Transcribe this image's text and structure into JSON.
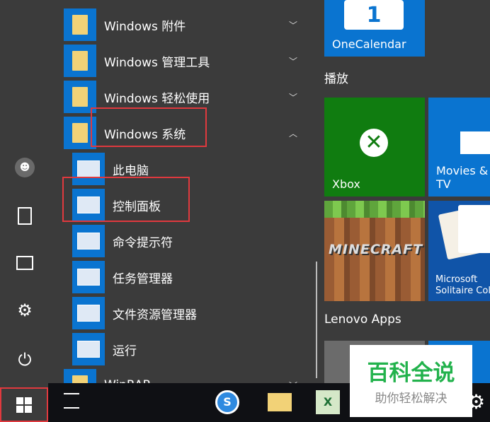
{
  "rail": {
    "icons": [
      "user-icon",
      "document-icon",
      "pictures-icon",
      "settings-icon",
      "power-icon"
    ]
  },
  "apps": [
    {
      "label": "Windows 附件",
      "type": "folder",
      "expanded": false
    },
    {
      "label": "Windows 管理工具",
      "type": "folder",
      "expanded": false
    },
    {
      "label": "Windows 轻松使用",
      "type": "folder",
      "expanded": false
    },
    {
      "label": "Windows 系统",
      "type": "folder",
      "expanded": true
    },
    {
      "label": "此电脑",
      "type": "app"
    },
    {
      "label": "控制面板",
      "type": "app"
    },
    {
      "label": "命令提示符",
      "type": "app"
    },
    {
      "label": "任务管理器",
      "type": "app"
    },
    {
      "label": "文件资源管理器",
      "type": "app"
    },
    {
      "label": "运行",
      "type": "app"
    },
    {
      "label": "WinRAR",
      "type": "folder",
      "expanded": false
    }
  ],
  "tiles": {
    "onecalendar": "OneCalendar",
    "section_play": "播放",
    "xbox": "Xbox",
    "movies": "Movies & TV",
    "minecraft": "MINECRAFT",
    "solitaire_1": "Microsoft",
    "solitaire_2": "Solitaire Collection",
    "section_lenovo": "Lenovo Apps"
  },
  "watermark": {
    "title": "百科全说",
    "subtitle": "助你轻松解决"
  },
  "colors": {
    "accent": "#0a74d0",
    "xbox": "#107c10",
    "highlight": "#e0393e",
    "watermark": "#22b24c"
  }
}
